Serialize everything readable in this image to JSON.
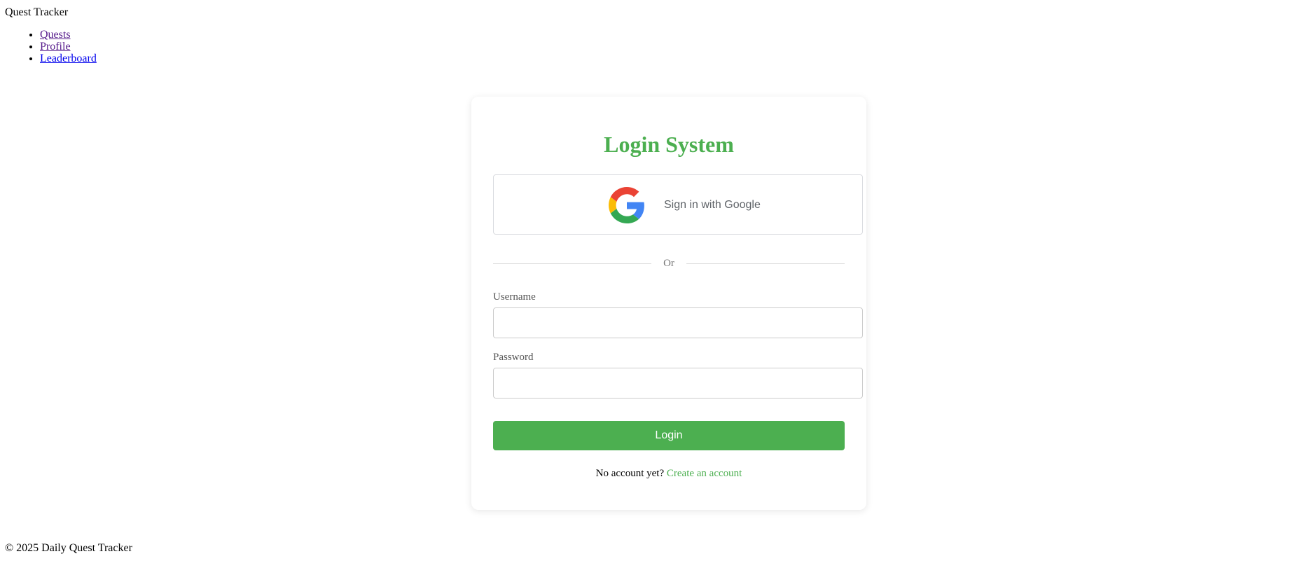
{
  "header": {
    "app_title": "Quest Tracker"
  },
  "nav": {
    "items": [
      {
        "label": "Quests"
      },
      {
        "label": "Profile"
      },
      {
        "label": "Leaderboard"
      }
    ]
  },
  "login_card": {
    "title": "Login System",
    "google_button_label": "Sign in with Google",
    "divider_text": "Or",
    "username_label": "Username",
    "username_value": "",
    "password_label": "Password",
    "password_value": "",
    "login_button_label": "Login",
    "signup_prompt": "No account yet?",
    "signup_link": "Create an account"
  },
  "footer": {
    "text": "© 2025 Daily Quest Tracker"
  },
  "colors": {
    "accent": "#4caf50",
    "google_blue": "#4285F4",
    "google_red": "#EA4335",
    "google_yellow": "#FBBC05",
    "google_green": "#34A853"
  },
  "icons": {
    "google": "google-g-logo-icon"
  }
}
